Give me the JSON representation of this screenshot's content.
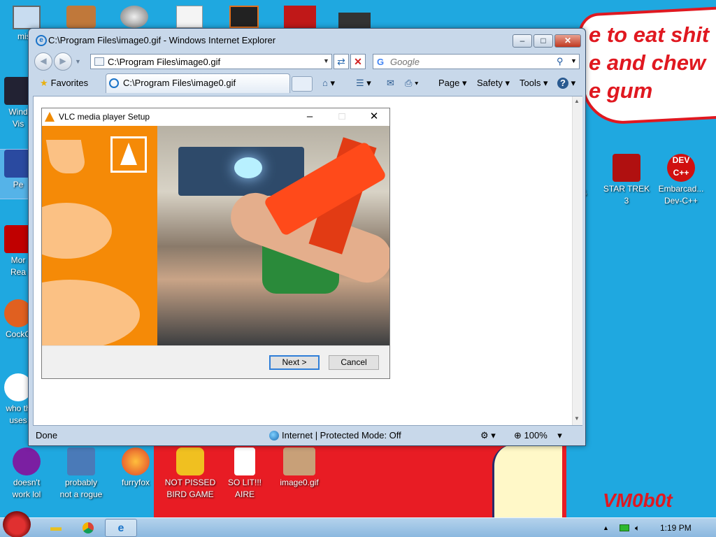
{
  "wallpaper": {
    "caption": "e to eat shit\ne and chew\ne gum",
    "signature": "VM0b0t"
  },
  "desktop_icons": [
    {
      "label": "mist"
    },
    {
      "label": "Wind\nVis"
    },
    {
      "label": "Pe"
    },
    {
      "label": "Mor\nRea"
    },
    {
      "label": "CockC"
    },
    {
      "label": "who th\nuses"
    },
    {
      "label": "S"
    },
    {
      "label": "STAR TREK\n3"
    },
    {
      "label": "Embarcad...\nDev-C++"
    },
    {
      "label": "doesn't\nwork lol"
    },
    {
      "label": "probably\nnot a rogue"
    },
    {
      "label": "furryfox"
    },
    {
      "label": "NOT PISSED\nBIRD GAME"
    },
    {
      "label": "SO LIT!!!\nAIRE"
    },
    {
      "label": "image0.gif"
    }
  ],
  "ie": {
    "title": "C:\\Program Files\\image0.gif - Windows Internet Explorer",
    "address": "C:\\Program Files\\image0.gif",
    "search_placeholder": "Google",
    "favorites": "Favorites",
    "tab": "C:\\Program Files\\image0.gif",
    "menus": {
      "page": "Page",
      "safety": "Safety",
      "tools": "Tools"
    },
    "status": {
      "left": "Done",
      "zone": "Internet | Protected Mode: Off",
      "zoom": "100%"
    }
  },
  "vlc": {
    "title": "VLC media player Setup",
    "next": "Next >",
    "cancel": "Cancel"
  },
  "taskbar": {
    "clock": "1:19 PM"
  },
  "colors": {
    "accent": "#f58a07",
    "desktop": "#1fa8e0",
    "wall_red": "#e81c24"
  }
}
